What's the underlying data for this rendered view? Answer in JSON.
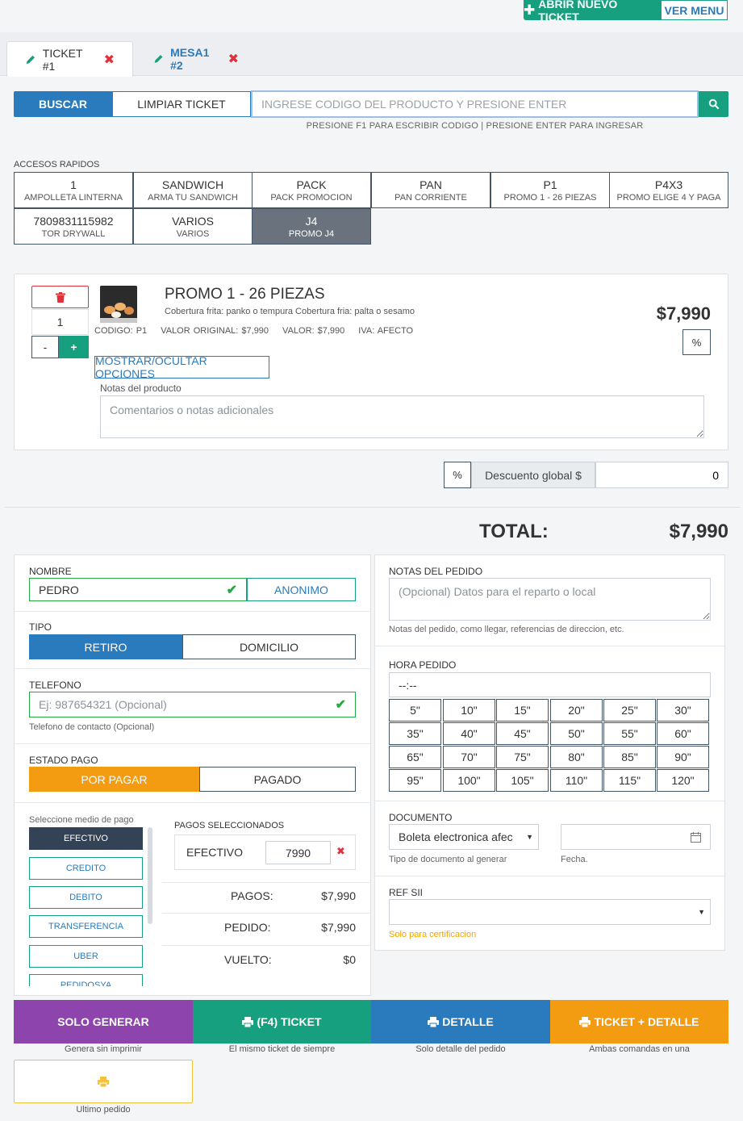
{
  "header": {
    "new_ticket": "ABRIR NUEVO TICKET",
    "menu": "VER MENU"
  },
  "tabs": [
    {
      "label": "TICKET #1"
    },
    {
      "label": "MESA1 #2"
    }
  ],
  "search": {
    "buscar": "BUSCAR",
    "limpiar": "LIMPIAR TICKET",
    "placeholder": "INGRESE CODIGO DEL PRODUCTO Y PRESIONE ENTER",
    "hint": "PRESIONE F1 PARA ESCRIBIR CODIGO | PRESIONE ENTER PARA INGRESAR"
  },
  "quick_access": {
    "label": "ACCESOS RAPIDOS",
    "items": [
      {
        "title": "1",
        "sub": "AMPOLLETA LINTERNA"
      },
      {
        "title": "SANDWICH",
        "sub": "ARMA TU SANDWICH"
      },
      {
        "title": "PACK",
        "sub": "PACK PROMOCION"
      },
      {
        "title": "PAN",
        "sub": "PAN CORRIENTE"
      },
      {
        "title": "P1",
        "sub": "PROMO 1 - 26 PIEZAS"
      },
      {
        "title": "P4X3",
        "sub": "PROMO ELIGE 4 Y PAGA"
      },
      {
        "title": "7809831115982",
        "sub": "TOR DRYWALL"
      },
      {
        "title": "VARIOS",
        "sub": "VARIOS"
      },
      {
        "title": "J4",
        "sub": "PROMO J4"
      }
    ]
  },
  "product": {
    "qty": "1",
    "minus": "-",
    "plus": "+",
    "title": "PROMO 1 - 26 PIEZAS",
    "desc": "Cobertura frita: panko o tempura Cobertura fria: palta o sesamo",
    "codigo": "CODIGO: P1",
    "valor_original": "VALOR ORIGINAL: $7,990",
    "valor": "VALOR: $7,990",
    "iva": "IVA: AFECTO",
    "price": "$7,990",
    "pct": "%",
    "options_btn": "MOSTRAR/OCULTAR OPCIONES",
    "notes_label": "Notas del producto",
    "notes_placeholder": "Comentarios o notas adicionales"
  },
  "discount": {
    "pct": "%",
    "label": "Descuento global $",
    "value": "0"
  },
  "total": {
    "label": "TOTAL:",
    "value": "$7,990"
  },
  "form": {
    "nombre_label": "NOMBRE",
    "nombre_value": "PEDRO",
    "anonimo": "ANONIMO",
    "tipo_label": "TIPO",
    "retiro": "RETIRO",
    "domicilio": "DOMICILIO",
    "telefono_label": "TELEFONO",
    "telefono_placeholder": "Ej: 987654321 (Opcional)",
    "telefono_help": "Telefono de contacto (Opcional)",
    "estado_label": "ESTADO PAGO",
    "por_pagar": "POR PAGAR",
    "pagado": "PAGADO",
    "medio_label": "Seleccione medio de pago",
    "medios": [
      "EFECTIVO",
      "CREDITO",
      "DEBITO",
      "TRANSFERENCIA",
      "UBER",
      "PEDIDOSYA"
    ],
    "pagos_sel_label": "PAGOS SELECCIONADOS",
    "pago_nombre": "EFECTIVO",
    "pago_valor": "7990",
    "pagos_label": "PAGOS:",
    "pagos_value": "$7,990",
    "pedido_label": "PEDIDO:",
    "pedido_value": "$7,990",
    "vuelto_label": "VUELTO:",
    "vuelto_value": "$0"
  },
  "right": {
    "notas_label": "NOTAS DEL PEDIDO",
    "notas_placeholder": "(Opcional) Datos para el reparto o local",
    "notas_help": "Notas del pedido, como llegar, referencias de direccion, etc.",
    "hora_label": "HORA PEDIDO",
    "hora_value": "--:--",
    "minutes": [
      "5\"",
      "10\"",
      "15\"",
      "20\"",
      "25\"",
      "30\"",
      "35\"",
      "40\"",
      "45\"",
      "50\"",
      "55\"",
      "60\"",
      "65\"",
      "70\"",
      "75\"",
      "80\"",
      "85\"",
      "90\"",
      "95\"",
      "100\"",
      "105\"",
      "110\"",
      "115\"",
      "120\""
    ],
    "doc_label": "DOCUMENTO",
    "doc_value": "Boleta electronica afec",
    "doc_help": "Tipo de documento al generar",
    "fecha_help": "Fecha.",
    "ref_label": "REF SII",
    "ref_help": "Solo para certificacion"
  },
  "actions": {
    "solo": "SOLO GENERAR",
    "solo_sub": "Genera sin imprimir",
    "ticket": "(F4) TICKET",
    "ticket_sub": "El mismo ticket de siempre",
    "detalle": "DETALLE",
    "detalle_sub": "Solo detalle del pedido",
    "ticket_detalle": "TICKET + DETALLE",
    "ticket_detalle_sub": "Ambas comandas en una",
    "ultimo_sub": "Ultimo pedido"
  },
  "colors": {
    "primary": "#2a7bbd",
    "success": "#17a07f",
    "danger": "#e0303a",
    "warning": "#f39c12",
    "purple": "#8e44ad",
    "dark": "#344256"
  }
}
